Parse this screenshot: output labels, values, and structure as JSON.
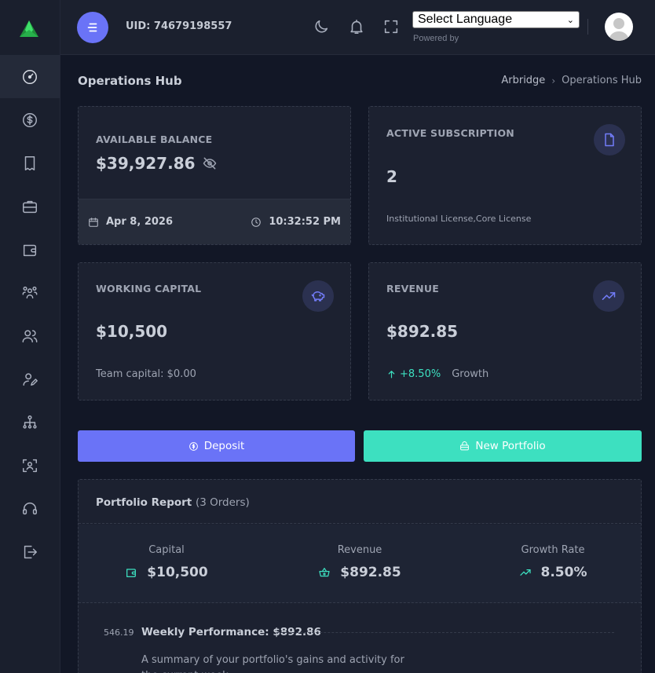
{
  "header": {
    "uid": "UID: 74679198557",
    "language_select": "Select Language",
    "powered_by": "Powered by"
  },
  "page": {
    "title": "Operations Hub",
    "breadcrumb": [
      "Arbridge",
      "Operations Hub"
    ]
  },
  "cards": {
    "balance": {
      "label": "AVAILABLE BALANCE",
      "value": "$39,927.86",
      "date": "Apr 8, 2026",
      "time": "10:32:52 PM"
    },
    "subscription": {
      "label": "ACTIVE SUBSCRIPTION",
      "value": "2",
      "sub": "Institutional License,Core License"
    },
    "working_capital": {
      "label": "WORKING CAPITAL",
      "value": "$10,500",
      "sub": "Team capital: $0.00"
    },
    "revenue": {
      "label": "REVENUE",
      "value": "$892.85",
      "growth": "+8.50%",
      "growth_label": "Growth"
    }
  },
  "actions": {
    "deposit": "Deposit",
    "new_portfolio": "New Portfolio"
  },
  "portfolio": {
    "title": "Portfolio Report",
    "count": "(3 Orders)",
    "stats": [
      {
        "label": "Capital",
        "value": "$10,500"
      },
      {
        "label": "Revenue",
        "value": "$892.85"
      },
      {
        "label": "Growth Rate",
        "value": "8.50%"
      }
    ],
    "row_number": "546.19",
    "performance": "Weekly Performance: $892.86",
    "description": "A summary of your portfolio's gains and activity for the current week."
  },
  "colors": {
    "accent": "#6a73f7",
    "teal": "#3de0c0",
    "background": "#121726",
    "card": "#1c2130"
  },
  "icons": {
    "sidebar": [
      "dashboard-icon",
      "dollar-icon",
      "receipt-icon",
      "briefcase-icon",
      "wallet-icon",
      "team-icon",
      "users-icon",
      "user-edit-icon",
      "hierarchy-icon",
      "face-scan-icon",
      "headset-icon",
      "logout-icon"
    ]
  }
}
